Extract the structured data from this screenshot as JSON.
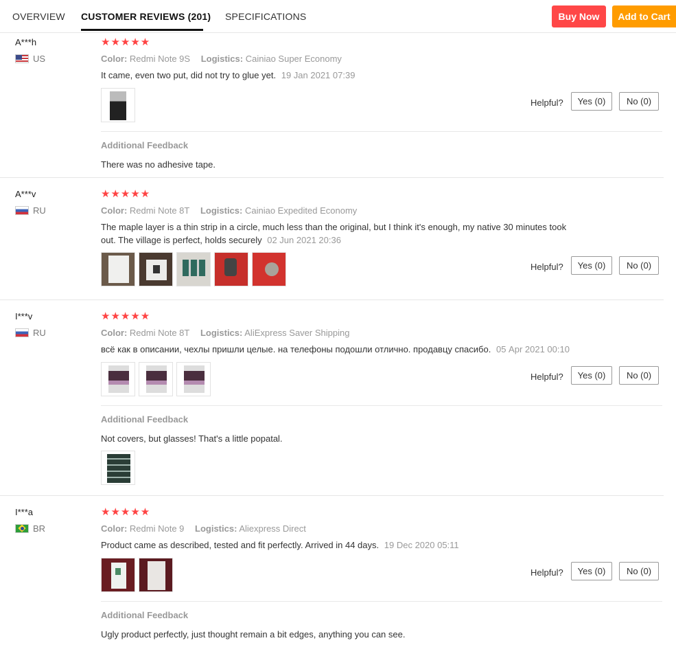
{
  "tabs": {
    "overview": "OVERVIEW",
    "reviews": "CUSTOMER REVIEWS (201)",
    "specs": "SPECIFICATIONS"
  },
  "actions": {
    "buy_now": "Buy Now",
    "add_to_cart": "Add to Cart"
  },
  "labels": {
    "color": "Color:",
    "logistics": "Logistics:",
    "helpful": "Helpful?",
    "additional_feedback": "Additional Feedback"
  },
  "colors": {
    "star": "#ff4444",
    "buy_now_bg": "#ff4747",
    "add_to_cart_bg": "#ff9c00"
  },
  "reviews": [
    {
      "name": "A***h",
      "country": "US",
      "stars": "★★★★★",
      "color": "Redmi Note 9S",
      "logistics": "Cainiao Super Economy",
      "text": "It came, even two put, did not try to glue yet.",
      "date": "19 Jan 2021 07:39",
      "yes": "Yes (0)",
      "no": "No (0)",
      "feedback": "There was no adhesive tape."
    },
    {
      "name": "A***v",
      "country": "RU",
      "stars": "★★★★★",
      "color": "Redmi Note 8T",
      "logistics": "Cainiao Expedited Economy",
      "text_line1": "The maple layer is a thin strip in a circle, much less than the original, but I think it's enough, my native 30 minutes took",
      "text_line2": "out. The village is perfect, holds securely",
      "date": "02 Jun 2021 20:36",
      "yes": "Yes (0)",
      "no": "No (0)"
    },
    {
      "name": "I***v",
      "country": "RU",
      "stars": "★★★★★",
      "color": "Redmi Note 8T",
      "logistics": "AliExpress Saver Shipping",
      "text": "всё как в описании, чехлы пришли целые. на телефоны подошли отлично. продавцу спасибо.",
      "date": "05 Apr 2021 00:10",
      "yes": "Yes (0)",
      "no": "No (0)",
      "feedback": "Not covers, but glasses! That's a little popatal."
    },
    {
      "name": "I***a",
      "country": "BR",
      "stars": "★★★★★",
      "color": "Redmi Note 9",
      "logistics": "Aliexpress Direct",
      "text": "Product came as described, tested and fit perfectly. Arrived in 44 days.",
      "date": "19 Dec 2020 05:11",
      "yes": "Yes (0)",
      "no": "No (0)",
      "feedback": "Ugly product perfectly, just thought remain a bit edges, anything you can see."
    }
  ]
}
